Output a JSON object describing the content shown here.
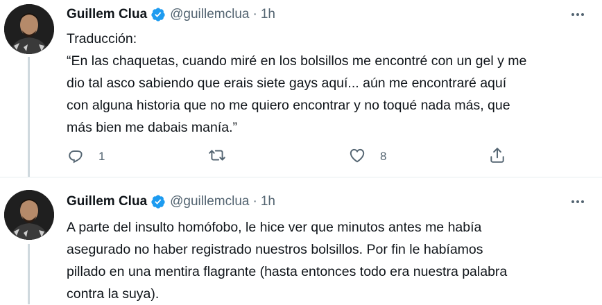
{
  "tweets": [
    {
      "author_name": "Guillem Clua",
      "handle": "@guillemclua",
      "separator": "·",
      "time": "1h",
      "lines": [
        "Traducción:",
        "“En las chaquetas, cuando miré en los bolsillos me encontré con un gel y me",
        "dio tal asco sabiendo que erais siete gays aquí... aún me encontraré aquí",
        "con alguna historia que no me quiero encontrar y no toqué nada más, que",
        "más bien me dabais manía.”"
      ],
      "reply_count": "1",
      "retweet_count": "",
      "like_count": "8"
    },
    {
      "author_name": "Guillem Clua",
      "handle": "@guillemclua",
      "separator": "·",
      "time": "1h",
      "lines": [
        "A parte del insulto homófobo, le hice ver que minutos antes me había",
        "asegurado no haber registrado nuestros bolsillos. Por fin le habíamos",
        "pillado en una mentira flagrante (hasta entonces todo era nuestra palabra",
        "contra la suya)."
      ]
    }
  ],
  "icons": {
    "verified": "verified-badge-icon",
    "more": "more-dots-icon",
    "reply": "reply-icon",
    "retweet": "retweet-icon",
    "like": "heart-icon",
    "share": "share-icon"
  },
  "colors": {
    "verified": "#1d9bf0",
    "secondary_text": "#536471",
    "text": "#0f1419"
  }
}
